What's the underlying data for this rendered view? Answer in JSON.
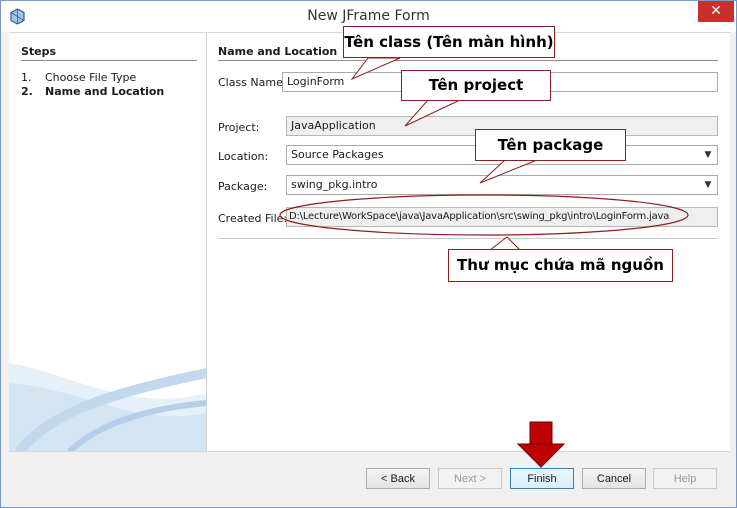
{
  "window": {
    "title": "New JFrame Form",
    "close_glyph": "✕"
  },
  "steps": {
    "title": "Steps",
    "items": [
      {
        "num": "1.",
        "label": "Choose File Type"
      },
      {
        "num": "2.",
        "label": "Name and Location"
      }
    ]
  },
  "panel": {
    "title": "Name and Location",
    "class_name": {
      "label": "Class Name:",
      "value": "LoginForm"
    },
    "project": {
      "label": "Project:",
      "value": "JavaApplication"
    },
    "location": {
      "label": "Location:",
      "value": "Source Packages"
    },
    "package": {
      "label": "Package:",
      "value": "swing_pkg.intro"
    },
    "created_file": {
      "label": "Created File:",
      "value": "D:\\Lecture\\WorkSpace\\java\\JavaApplication\\src\\swing_pkg\\intro\\LoginForm.java"
    }
  },
  "buttons": {
    "back": "< Back",
    "next": "Next >",
    "finish": "Finish",
    "cancel": "Cancel",
    "help": "Help"
  },
  "annotations": {
    "class_callout": "Tên class (Tên màn hình)",
    "project_callout": "Tên project",
    "package_callout": "Tên package",
    "folder_callout": "Thư mục chứa mã nguồn"
  },
  "colors": {
    "callout_border": "#8b1e1e",
    "arrow_red": "#c00000",
    "close_red": "#c7302b"
  }
}
